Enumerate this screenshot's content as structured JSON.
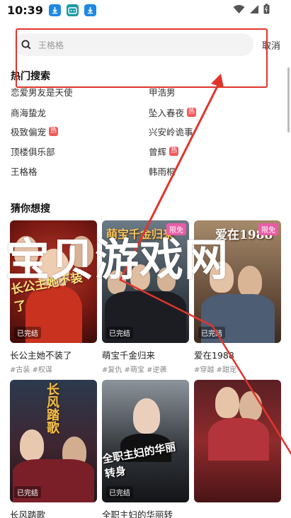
{
  "status_bar": {
    "time": "10:39"
  },
  "search": {
    "placeholder": "王格格",
    "cancel_label": "取消"
  },
  "hot_search": {
    "title": "热门搜索",
    "items_left": [
      {
        "label": "恋爱男友是天使",
        "badge": ""
      },
      {
        "label": "商海蛰龙",
        "badge": ""
      },
      {
        "label": "极致偏宠",
        "badge": "热"
      },
      {
        "label": "顶楼俱乐部",
        "badge": ""
      },
      {
        "label": "王格格",
        "badge": ""
      }
    ],
    "items_right": [
      {
        "label": "甲浩男",
        "badge": ""
      },
      {
        "label": "坠入春夜",
        "badge": "热"
      },
      {
        "label": "兴安岭诡事",
        "badge": ""
      },
      {
        "label": "曾辉",
        "badge": "热"
      },
      {
        "label": "韩雨桐",
        "badge": ""
      }
    ]
  },
  "guess": {
    "title": "猜你想搜",
    "cards": [
      {
        "title": "长公主她不装了",
        "tags": "#古装 #权谋",
        "status": "已完结",
        "badge": "",
        "caption": "长公主她不装了"
      },
      {
        "title": "萌宝千金归来",
        "tags": "#复仇 #萌宝 #逆袭",
        "status": "已完结",
        "badge": "限免",
        "caption": "萌宝千金归来"
      },
      {
        "title": "爱在1988",
        "tags": "#穿越 #甜宠",
        "status": "已完结",
        "badge": "限免",
        "caption": "爱在1988"
      },
      {
        "title": "长风踏歌",
        "tags": "",
        "status": "已完结",
        "badge": "",
        "caption": "长风踏歌"
      },
      {
        "title": "全职主妇的华丽转",
        "tags": "",
        "status": "已完结",
        "badge": "",
        "caption": "全职主妇的华丽转身"
      },
      {
        "title": "",
        "tags": "",
        "status": "",
        "badge": "",
        "caption": ""
      }
    ]
  },
  "watermark": {
    "text": "宝贝游戏网"
  },
  "colors": {
    "accent_red": "#e0352b",
    "hot_badge": "#f05a5a",
    "free_badge": "#e85da7",
    "app_icon_blue": "#1e88e5",
    "app_icon_teal": "#1a9ba3"
  }
}
